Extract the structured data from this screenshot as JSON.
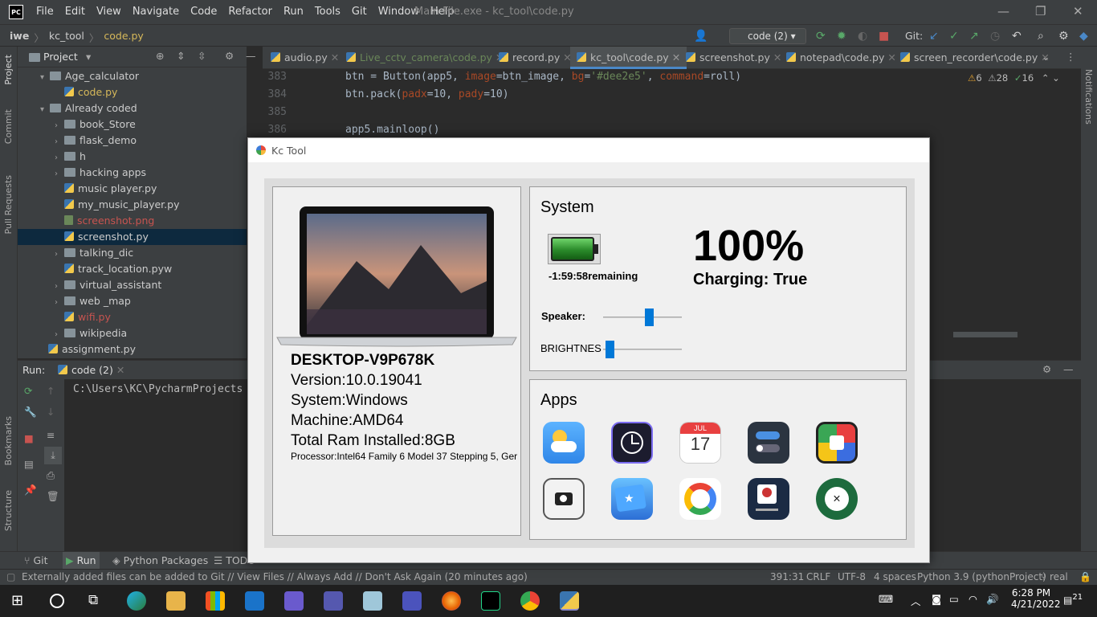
{
  "ide": {
    "window_title": "Main File.exe - kc_tool\\code.py",
    "menu": [
      "File",
      "Edit",
      "View",
      "Navigate",
      "Code",
      "Refactor",
      "Run",
      "Tools",
      "Git",
      "Window",
      "Help"
    ],
    "breadcrumb": [
      "iwe",
      "kc_tool",
      "code.py"
    ],
    "run_config": "code (2)",
    "git_label": "Git:",
    "project_label": "Project",
    "side_tabs": [
      "Project",
      "Commit",
      "Pull Requests",
      "Bookmarks",
      "Structure"
    ],
    "right_tab": "Notifications",
    "tree": [
      {
        "label": "Age_calculator",
        "type": "folder",
        "arrow": "▾"
      },
      {
        "label": "code.py",
        "type": "py"
      },
      {
        "label": "Already coded",
        "type": "folder",
        "arrow": "▾"
      },
      {
        "label": "book_Store",
        "type": "folder",
        "arrow": "›"
      },
      {
        "label": "flask_demo",
        "type": "folder",
        "arrow": "›"
      },
      {
        "label": "h",
        "type": "folder",
        "arrow": "›"
      },
      {
        "label": "hacking apps",
        "type": "folder",
        "arrow": "›"
      },
      {
        "label": "music player.py",
        "type": "py"
      },
      {
        "label": "my_music_player.py",
        "type": "py"
      },
      {
        "label": "screenshot.png",
        "type": "png"
      },
      {
        "label": "screenshot.py",
        "type": "py"
      },
      {
        "label": "talking_dic",
        "type": "folder",
        "arrow": "›"
      },
      {
        "label": "track_location.pyw",
        "type": "py"
      },
      {
        "label": "virtual_assistant",
        "type": "folder",
        "arrow": "›"
      },
      {
        "label": "web _map",
        "type": "folder",
        "arrow": "›"
      },
      {
        "label": "wifi.py",
        "type": "py"
      },
      {
        "label": "wikipedia",
        "type": "folder",
        "arrow": "›"
      },
      {
        "label": "assignment.py",
        "type": "py"
      }
    ],
    "tabs": [
      "audio.py",
      "Live_cctv_camera\\code.py",
      "record.py",
      "kc_tool\\code.py",
      "screenshot.py",
      "notepad\\code.py",
      "screen_recorder\\code.py"
    ],
    "inspections": {
      "warnings": "6",
      "weak": "28",
      "typos": "16"
    },
    "code_lines": [
      {
        "num": "383",
        "text": "btn = Button(app5, image=btn_image, bg='#dee2e5', command=roll)"
      },
      {
        "num": "384",
        "text": "btn.pack(padx=10, pady=10)"
      },
      {
        "num": "385",
        "text": ""
      },
      {
        "num": "386",
        "text": "app5.mainloop()"
      }
    ],
    "run_label": "Run:",
    "run_tab": "code (2)",
    "run_output": "C:\\Users\\KC\\PycharmProjects",
    "bottom_tabs": [
      "Git",
      "Run",
      "Python Packages",
      "TODO"
    ],
    "status_message": "Externally added files can be added to Git // View Files // Always Add // Don't Ask Again (20 minutes ago)",
    "status_right": [
      "391:31",
      "CRLF",
      "UTF-8",
      "4 spaces",
      "Python 3.9 (pythonProject)",
      "real"
    ]
  },
  "taskbar": {
    "time": "6:28 PM",
    "date": "4/21/2022",
    "notifications": "21"
  },
  "kc_tool": {
    "title": "Kc Tool",
    "device": {
      "name": "DESKTOP-V9P678K",
      "version": "Version:10.0.19041",
      "system": "System:Windows",
      "machine": "Machine:AMD64",
      "ram": "Total Ram Installed:8GB",
      "processor": "Processor:Intel64 Family 6 Model 37 Stepping 5, Ger"
    },
    "system": {
      "heading": "System",
      "battery_remaining": "-1:59:58remaining",
      "battery_percent": "100%",
      "charging": "Charging: True",
      "speaker_label": "Speaker:",
      "speaker_level": 0.6,
      "brightness_label": "BRIGHTNES",
      "brightness_level": 0.03
    },
    "apps": {
      "heading": "Apps",
      "icons": [
        "weather-icon",
        "clock-icon",
        "calendar-icon",
        "toggle-settings-icon",
        "ludo-game-icon",
        "screenshot-camera-icon",
        "files-folder-icon",
        "google-icon",
        "screen-recorder-icon",
        "close-app-icon"
      ],
      "calendar_month": "JUL",
      "calendar_day": "17"
    }
  }
}
